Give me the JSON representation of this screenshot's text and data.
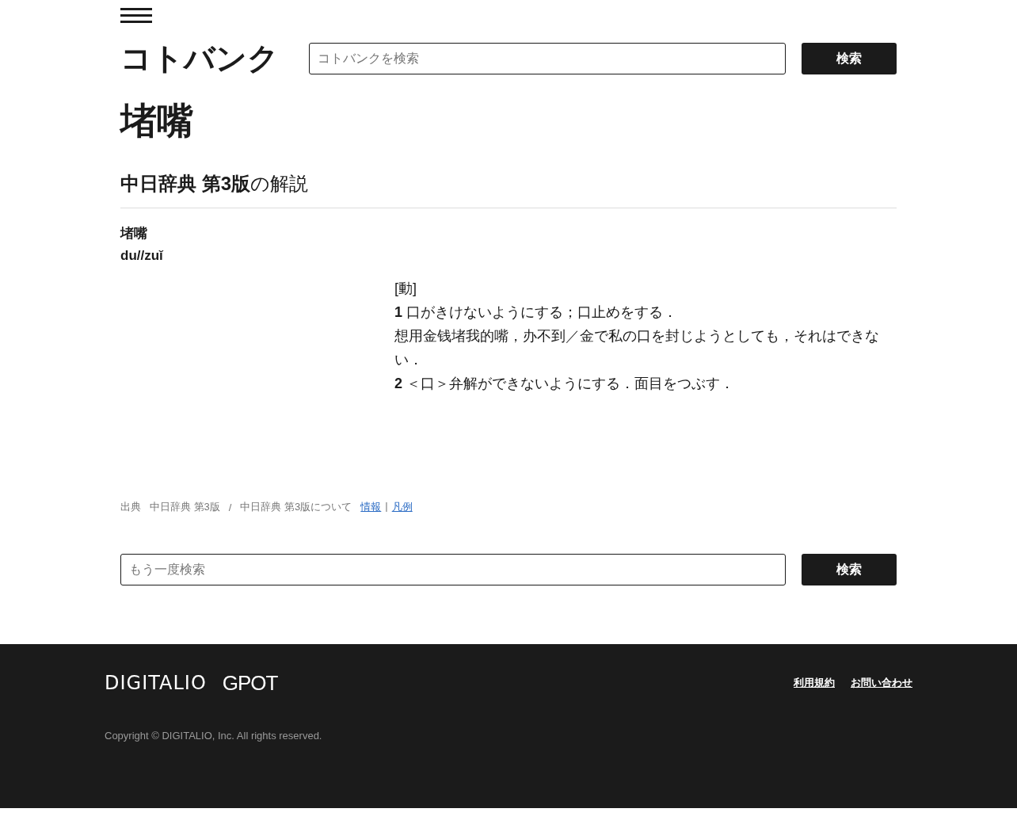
{
  "header": {
    "logo": "コトバンク",
    "search": {
      "placeholder": "コトバンクを検索",
      "button": "検索"
    }
  },
  "title": "堵嘴",
  "section": {
    "heading": "**中日辞典 第3版**の解説",
    "headword": "堵嘴",
    "pinyin": "du//zuǐ",
    "lines": [
      "[動]",
      "**1** 口がきけないようにする；口止めをする．",
      "想用金钱堵我的嘴，办不到／金で私の口を封じようとしても，それはできない．",
      "**2** ＜口＞弁解ができないようにする．面目をつぶす．"
    ]
  },
  "source": {
    "label": "出典",
    "dictionary": "中日辞典 第3版",
    "separator": "/",
    "about": "中日辞典 第3版について",
    "links": [
      "情報",
      "凡例"
    ],
    "link_separator": "|"
  },
  "search_again": {
    "placeholder": "もう一度検索",
    "button": "検索"
  },
  "footer": {
    "logos": [
      "DIGITALIO",
      "GPOT"
    ],
    "links": [
      "利用規約",
      "お問い合わせ"
    ],
    "copyright": "Copyright © DIGITALIO, Inc. All rights reserved."
  }
}
